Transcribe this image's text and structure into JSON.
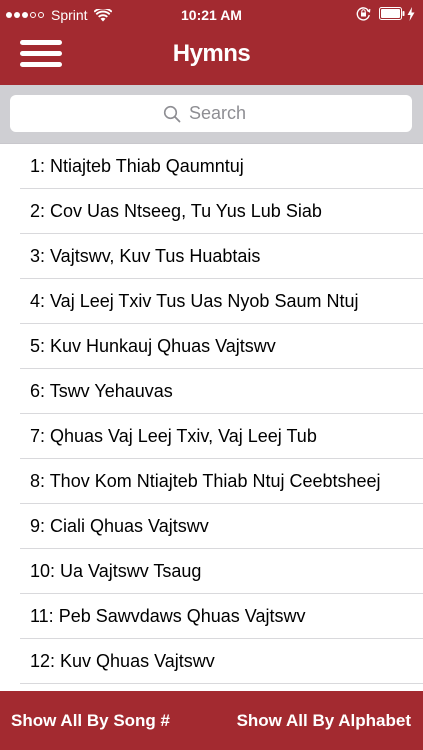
{
  "status_bar": {
    "signal_full": 3,
    "signal_empty": 2,
    "carrier": "Sprint",
    "time": "10:21 AM"
  },
  "colors": {
    "brand_red": "#a32a30",
    "search_bg": "#cfcfd3"
  },
  "nav": {
    "title": "Hymns",
    "menu_icon": "hamburger-menu-icon"
  },
  "search": {
    "placeholder": "Search",
    "value": ""
  },
  "hymns": [
    "1: Ntiajteb Thiab Qaumntuj",
    "2: Cov Uas Ntseeg, Tu Yus Lub Siab",
    "3: Vajtswv, Kuv Tus Huabtais",
    "4: Vaj Leej Txiv Tus Uas Nyob Saum Ntuj",
    "5: Kuv Hunkauj Qhuas Vajtswv",
    "6: Tswv Yehauvas",
    "7: Qhuas Vaj Leej Txiv, Vaj Leej Tub",
    "8: Thov Kom Ntiajteb Thiab Ntuj Ceebtsheej",
    "9: Ciali Qhuas Vajtswv",
    "10: Ua Vajtswv Tsaug",
    "11: Peb Sawvdaws Qhuas Vajtswv",
    "12: Kuv Qhuas Vajtswv"
  ],
  "footer": {
    "left_button": "Show All By Song #",
    "right_button": "Show All By Alphabet"
  }
}
